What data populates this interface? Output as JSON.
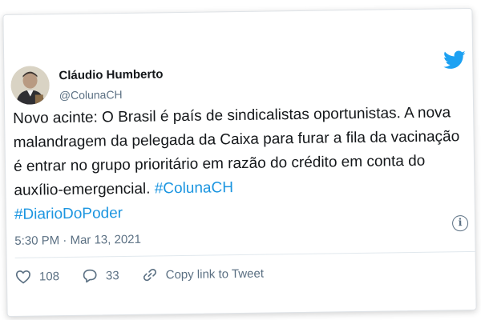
{
  "tweet": {
    "author": {
      "display_name": "Cláudio Humberto",
      "handle": "@ColunaCH"
    },
    "text_plain": "Novo acinte: O Brasil é país de sindicalistas oportunistas. A nova malandragem da pelegada da Caixa para furar a fila da vacinação é entrar no grupo prioritário em razão do crédito em conta do auxílio-emergencial.",
    "hashtags": [
      "#ColunaCH",
      "#DiarioDoPoder"
    ],
    "timestamp": "5:30 PM · Mar 13, 2021",
    "likes": "108",
    "replies": "33",
    "copy_link_label": "Copy link to Tweet"
  },
  "icons": {
    "brand": "twitter-bird-icon",
    "info": "info-icon",
    "like": "heart-icon",
    "reply": "reply-bubble-icon",
    "copy_link": "link-icon"
  },
  "colors": {
    "brand_blue": "#1da1f2",
    "hashtag_blue": "#1b95e0",
    "text": "#14171a",
    "secondary_text": "#5b7083"
  }
}
